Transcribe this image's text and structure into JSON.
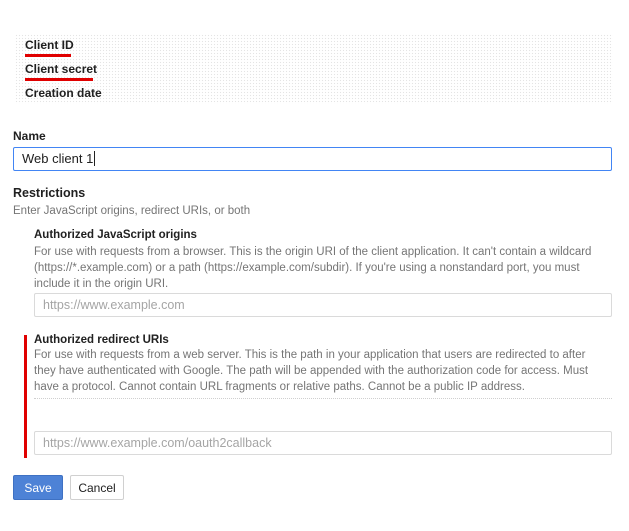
{
  "client_info": {
    "client_id_label": "Client ID",
    "client_secret_label": "Client secret",
    "creation_date_label": "Creation date"
  },
  "name": {
    "label": "Name",
    "value": "Web client 1"
  },
  "restrictions": {
    "title": "Restrictions",
    "subtitle": "Enter JavaScript origins, redirect URIs, or both",
    "js_origins": {
      "title": "Authorized JavaScript origins",
      "help": "For use with requests from a browser. This is the origin URI of the client application. It can't contain a wildcard (https://*.example.com) or a path (https://example.com/subdir). If you're using a nonstandard port, you must include it in the origin URI.",
      "placeholder": "https://www.example.com"
    },
    "redirect_uris": {
      "title": "Authorized redirect URIs",
      "help": "For use with requests from a web server. This is the path in your application that users are redirected to after they have authenticated with Google. The path will be appended with the authorization code for access. Must have a protocol. Cannot contain URL fragments or relative paths. Cannot be a public IP address.",
      "placeholder": "https://www.example.com/oauth2callback"
    }
  },
  "buttons": {
    "save": "Save",
    "cancel": "Cancel"
  },
  "colors": {
    "accent": "#4285f4",
    "save_button": "#4d82d6",
    "annotation_red": "#e00000"
  }
}
